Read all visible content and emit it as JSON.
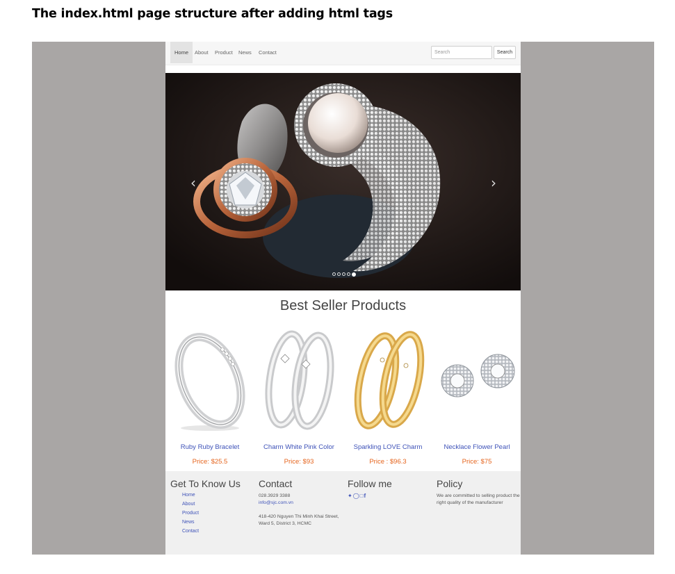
{
  "doc_heading": "The index.html page structure after adding html tags",
  "navbar": {
    "links": [
      "Home",
      "About",
      "Product",
      "News",
      "Contact"
    ],
    "search_placeholder": "Search",
    "search_button": "Search"
  },
  "carousel": {
    "prev_icon": "chevron-left-icon",
    "next_icon": "chevron-right-icon",
    "slide_count": 5,
    "active_slide": 5
  },
  "products_section": {
    "title": "Best Seller Products",
    "items": [
      {
        "name": "Ruby Ruby Bracelet",
        "price": "Price: $25.5"
      },
      {
        "name": "Charm White Pink Color",
        "price": "Price: $93"
      },
      {
        "name": "Sparkling LOVE Charm",
        "price": "Price : $96.3"
      },
      {
        "name": "Necklace Flower Pearl",
        "price": "Price: $75"
      }
    ]
  },
  "footer": {
    "know_us": {
      "title": "Get To Know Us",
      "links": [
        "Home",
        "About",
        "Product",
        "News",
        "Contact"
      ]
    },
    "contact": {
      "title": "Contact",
      "phone": "028.3929 3388",
      "email": "info@sjc.com.vn",
      "address_line1": "418-420 Nguyen Thi Minh Khai Street,",
      "address_line2": "Ward 5, District 3, HCMC"
    },
    "follow": {
      "title": "Follow me",
      "icons": [
        "twitter-icon",
        "pinterest-icon",
        "instagram-icon",
        "facebook-icon"
      ]
    },
    "policy": {
      "title": "Policy",
      "text_line1": "We are committed to selling product the",
      "text_line2": "right quality of the manufacturer"
    }
  },
  "colors": {
    "frame_background": "#a9a6a5",
    "link": "#3e52b8",
    "price": "#e5641d",
    "footer_background": "#f0f0f0"
  }
}
